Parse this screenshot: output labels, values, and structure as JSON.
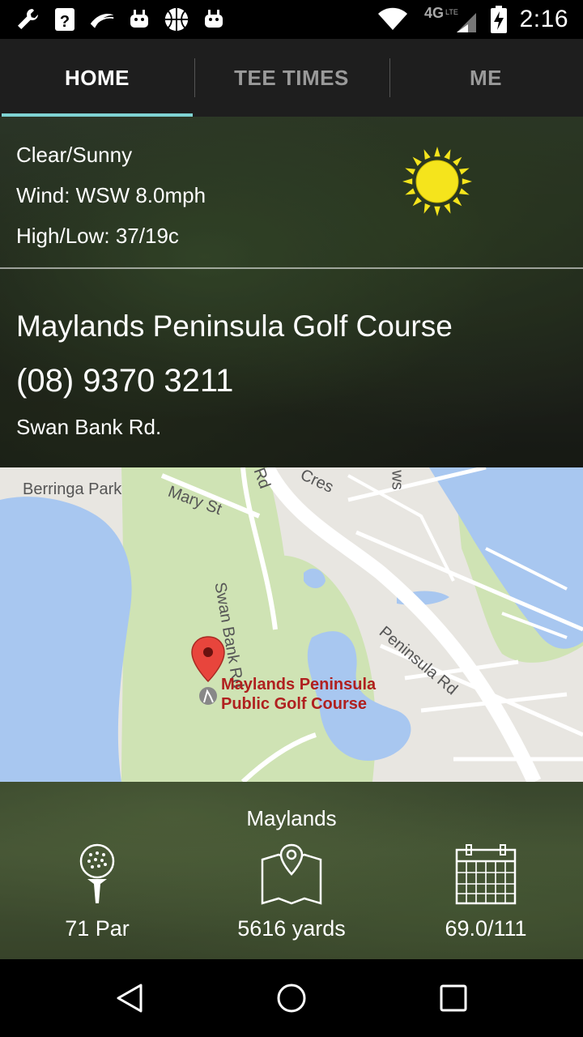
{
  "status_bar": {
    "time": "2:16",
    "network": "4G LTE",
    "icons": [
      "wrench-icon",
      "help-box-icon",
      "sprint-icon",
      "android-icon",
      "basketball-icon",
      "android-icon",
      "wifi-icon",
      "signal-icon",
      "battery-charging-icon"
    ]
  },
  "tabs": [
    {
      "label": "HOME",
      "active": true
    },
    {
      "label": "TEE TIMES",
      "active": false
    },
    {
      "label": "ME",
      "active": false
    }
  ],
  "weather": {
    "condition": "Clear/Sunny",
    "wind": "Wind: WSW 8.0mph",
    "high_low": "High/Low: 37/19c",
    "icon": "sun-icon",
    "sun_color": "#f5e41c"
  },
  "course": {
    "name": "Maylands Peninsula Golf Course",
    "phone": "(08) 9370 3211",
    "address": "Swan Bank Rd."
  },
  "map": {
    "labels": {
      "berringa": "Berringa Park",
      "mary": "Mary St",
      "swanbank": "Swan Bank Rd",
      "peninsula": "Peninsula Rd",
      "cres": "Cres",
      "rd": "Rd",
      "ws": "ws"
    },
    "poi_line1": "Maylands Peninsula",
    "poi_line2": "Public Golf Course",
    "water_color": "#a8c7f0",
    "park_color": "#cfe3b4",
    "marker_color": "#e8453c"
  },
  "info": {
    "title": "Maylands",
    "par": "71 Par",
    "yards": "5616 yards",
    "rating": "69.0/111"
  },
  "nav": {
    "back": "back-icon",
    "home": "home-icon",
    "recents": "recents-icon"
  }
}
